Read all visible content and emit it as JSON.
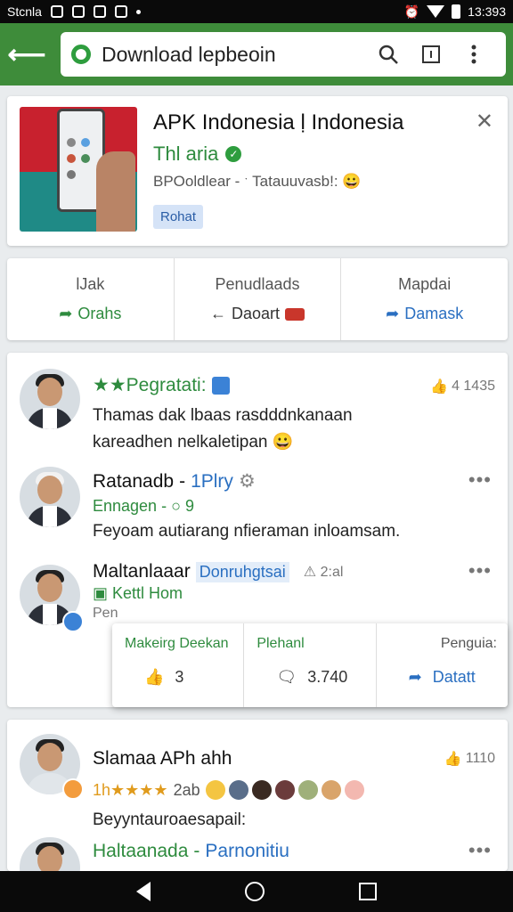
{
  "status_bar": {
    "left_text": "Stcnla",
    "time": "13:393"
  },
  "app_bar": {
    "url_text": "Download lepbeoin"
  },
  "app_card": {
    "title": "APK Indonesia ḷ Indonesia",
    "developer": "Thl aria",
    "meta": "BPOoldlear - ˑ Tatauuvasb!: 😀",
    "badge": "Rohat"
  },
  "actions": [
    {
      "label": "lJak",
      "sub": "Orahs",
      "color": "#2e8b3e"
    },
    {
      "label": "Penudlaads",
      "sub": "Daoart",
      "color": "#333333"
    },
    {
      "label": "Mapdai",
      "sub": "Damask",
      "color": "#2a6fc1"
    }
  ],
  "posts": [
    {
      "name": "★★Pegratati:",
      "count": "4 1435",
      "line1": "Thamas dak lbaas rasdddnkanaan",
      "line2": "kareadhen nelkaletipan 😀"
    },
    {
      "name": "Ratanadb",
      "name_suffix": "1Plry",
      "meta": "Ennagen - ○ 9",
      "line1": "Feyoam autiarang nfieraman inloamsam."
    },
    {
      "name": "Maltanlaaar",
      "tag": "Donruhgtsai",
      "time": "2:al",
      "meta": "Kettl Hom",
      "meta2": "Pen"
    }
  ],
  "popup": {
    "col1_label": "Makeirg Deekan",
    "col1_value": "3",
    "col2_label": "Plehanl",
    "col2_value": "3.740",
    "col3_label": "Penguia:",
    "col3_value": "Datatt"
  },
  "post4": {
    "name": "Slamaa APh ahh",
    "count": "1110",
    "rating_prefix": "1h★★★★",
    "rating_value": "2ab",
    "line1": "Beyyntauroaesapail:"
  },
  "post5": {
    "name": "Haltaanada",
    "tag": "Parnonitiu"
  },
  "colors": {
    "brand_green": "#3e8c3a",
    "accent_blue": "#2a6fc1",
    "text_green": "#2e8b3e"
  },
  "icons": [
    "back-arrow-icon",
    "search-icon",
    "tab-switch-icon",
    "overflow-menu-icon",
    "close-icon",
    "share-icon",
    "like-icon",
    "comment-icon"
  ]
}
